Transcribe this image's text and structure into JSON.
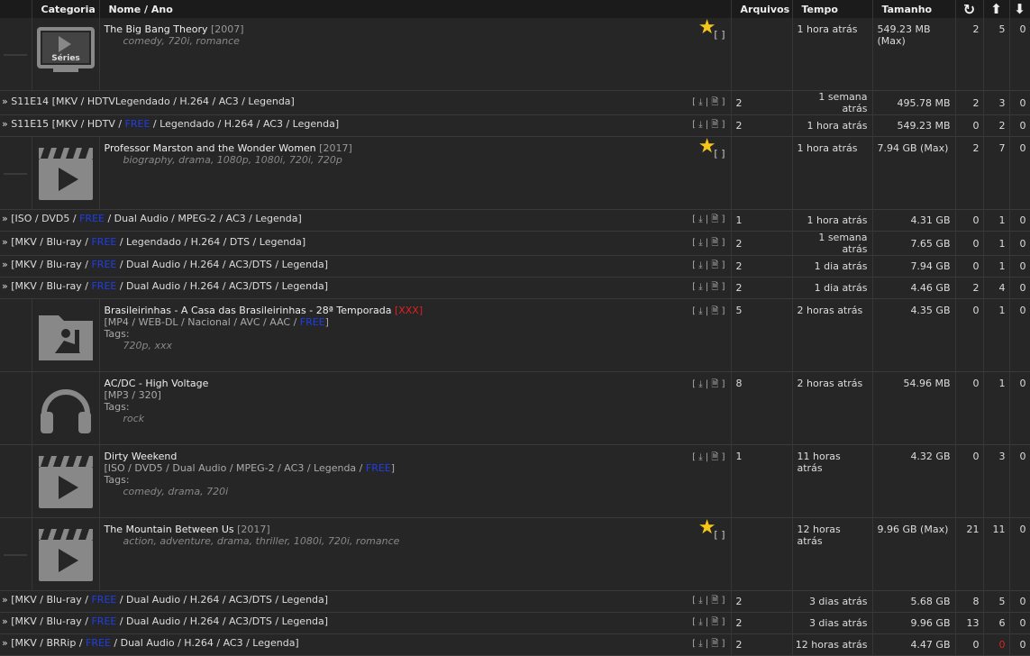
{
  "header": {
    "categoria": "Categoria",
    "nome": "Nome / Ano",
    "arquivos": "Arquivos",
    "tempo": "Tempo",
    "tamanho": "Tamanho"
  },
  "series_label": "Séries",
  "items": [
    {
      "kind": "main",
      "icon": "tv",
      "title": "The Big Bang Theory",
      "year": "[2007]",
      "tags": "comedy, 720i, romance",
      "files": "",
      "time": "1 hora atrás",
      "size": "549.23 MB (Max)",
      "c1": "2",
      "c2": "5",
      "c3": "0",
      "star": true
    },
    {
      "kind": "sub",
      "name": "S11E14 [MKV / HDTVLegendado / H.264 / AC3 / Legenda]",
      "files": "2",
      "time": "1 semana atrás",
      "size": "495.78 MB",
      "c1": "2",
      "c2": "3",
      "c3": "0"
    },
    {
      "kind": "sub",
      "pre": "S11E15 [MKV / HDTV / ",
      "free": "FREE",
      "post": " / Legendado / H.264 / AC3 / Legenda]",
      "files": "2",
      "time": "1 hora atrás",
      "size": "549.23 MB",
      "c1": "0",
      "c2": "2",
      "c3": "0"
    },
    {
      "kind": "main",
      "icon": "film",
      "title": "Professor Marston and the Wonder Women",
      "year": "[2017]",
      "tags": "biography, drama, 1080p, 1080i, 720i, 720p",
      "files": "",
      "time": "1 hora atrás",
      "size": "7.94 GB (Max)",
      "c1": "2",
      "c2": "7",
      "c3": "0",
      "star": true
    },
    {
      "kind": "sub",
      "pre": "[ISO / DVD5 / ",
      "free": "FREE",
      "post": " / Dual Audio / MPEG-2 / AC3 / Legenda]",
      "files": "1",
      "time": "1 hora atrás",
      "size": "4.31 GB",
      "c1": "0",
      "c2": "1",
      "c3": "0"
    },
    {
      "kind": "sub",
      "pre": "[MKV / Blu-ray / ",
      "free": "FREE",
      "post": " / Legendado / H.264 / DTS / Legenda]",
      "files": "2",
      "time": "1 semana atrás",
      "size": "7.65 GB",
      "c1": "0",
      "c2": "1",
      "c3": "0"
    },
    {
      "kind": "sub",
      "pre": "[MKV / Blu-ray / ",
      "free": "FREE",
      "post": " / Dual Audio / H.264 / AC3/DTS / Legenda]",
      "files": "2",
      "time": "1 dia atrás",
      "size": "7.94 GB",
      "c1": "0",
      "c2": "1",
      "c3": "0"
    },
    {
      "kind": "sub",
      "pre": "[MKV / Blu-ray / ",
      "free": "FREE",
      "post": " / Dual Audio / H.264 / AC3/DTS / Legenda]",
      "files": "2",
      "time": "1 dia atrás",
      "size": "4.46 GB",
      "c1": "2",
      "c2": "4",
      "c3": "0"
    },
    {
      "kind": "full",
      "icon": "adult",
      "title": "Brasileirinhas - A Casa das Brasileirinhas - 28ª Temporada",
      "badge": "[XXX]",
      "detpre": "[MP4 / WEB-DL / Nacional / AVC / AAC / ",
      "free": "FREE",
      "detpost": "]",
      "tags": "720p, xxx",
      "files": "5",
      "time": "2 horas atrás",
      "size": "4.35 GB",
      "c1": "0",
      "c2": "1",
      "c3": "0"
    },
    {
      "kind": "full",
      "icon": "music",
      "title": "AC/DC - High Voltage",
      "detpre": "[MP3 / 320]",
      "tags": "rock",
      "files": "8",
      "time": "2 horas atrás",
      "size": "54.96 MB",
      "c1": "0",
      "c2": "1",
      "c3": "0"
    },
    {
      "kind": "full",
      "icon": "film",
      "title": "Dirty Weekend",
      "detpre": "[ISO / DVD5 / Dual Audio / MPEG-2 / AC3 / Legenda / ",
      "free": "FREE",
      "detpost": "]",
      "tags": "comedy, drama, 720i",
      "files": "1",
      "time": "11 horas atrás",
      "size": "4.32 GB",
      "c1": "0",
      "c2": "3",
      "c3": "0"
    },
    {
      "kind": "main",
      "icon": "film",
      "title": "The Mountain Between Us",
      "year": "[2017]",
      "tags": "action, adventure, drama, thriller, 1080i, 720i, romance",
      "files": "",
      "time": "12 horas atrás",
      "size": "9.96 GB (Max)",
      "c1": "21",
      "c2": "11",
      "c3": "0",
      "star": true
    },
    {
      "kind": "sub",
      "pre": "[MKV / Blu-ray / ",
      "free": "FREE",
      "post": " / Dual Audio / H.264 / AC3/DTS / Legenda]",
      "files": "2",
      "time": "3 dias atrás",
      "size": "5.68 GB",
      "c1": "8",
      "c2": "5",
      "c3": "0"
    },
    {
      "kind": "sub",
      "pre": "[MKV / Blu-ray / ",
      "free": "FREE",
      "post": " / Dual Audio / H.264 / AC3/DTS / Legenda]",
      "files": "2",
      "time": "3 dias atrás",
      "size": "9.96 GB",
      "c1": "13",
      "c2": "6",
      "c3": "0"
    },
    {
      "kind": "sub",
      "pre": "[MKV / BRRip / ",
      "free": "FREE",
      "post": " / Dual Audio / H.264 / AC3 / Legenda]",
      "files": "2",
      "time": "12 horas atrás",
      "size": "4.47 GB",
      "c1": "0",
      "c2": "0",
      "c3": "0",
      "c2red": true
    }
  ],
  "tags_label": "Tags:",
  "tags_marker": "»"
}
